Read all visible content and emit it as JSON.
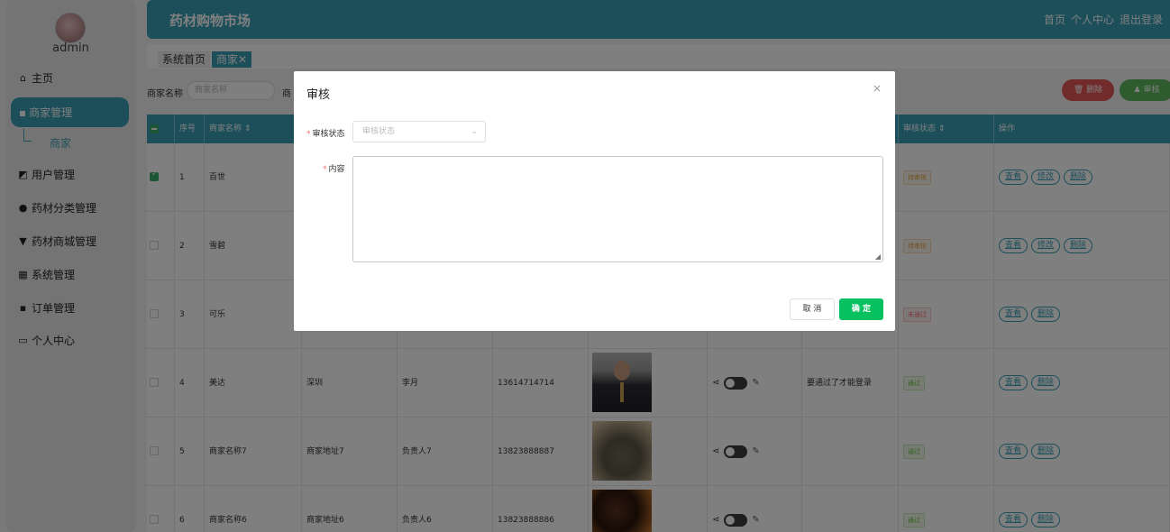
{
  "sidebar": {
    "username": "admin",
    "items": [
      {
        "label": "主页",
        "icon": "home-icon",
        "glyph": "⌂"
      },
      {
        "label": "商家管理",
        "icon": "grid-icon",
        "glyph": "▪"
      },
      {
        "label": "用户管理",
        "icon": "chart-icon",
        "glyph": "◩"
      },
      {
        "label": "药材分类管理",
        "icon": "drop-icon",
        "glyph": "●"
      },
      {
        "label": "药材商城管理",
        "icon": "shop-icon",
        "glyph": "▼"
      },
      {
        "label": "系统管理",
        "icon": "apps-icon",
        "glyph": "▦"
      },
      {
        "label": "订单管理",
        "icon": "order-icon",
        "glyph": "▪"
      },
      {
        "label": "个人中心",
        "icon": "card-icon",
        "glyph": "▭"
      }
    ],
    "sub_item": "商家"
  },
  "header": {
    "title": "药材购物市场",
    "links": [
      "首页",
      "个人中心",
      "退出登录"
    ]
  },
  "tabs": {
    "home": "系统首页",
    "active": "商家",
    "close_glyph": "✕"
  },
  "search": {
    "name_label": "商家名称",
    "name_placeholder": "商家名称",
    "second_label": "商",
    "delete_button": "删除",
    "audit_button": "审核"
  },
  "table": {
    "headers": {
      "index": "序号",
      "name": "商家名称",
      "audit_status": "审核状态",
      "actions": "操作"
    },
    "rows": [
      {
        "no": "1",
        "name": "百世",
        "address": "",
        "contact": "",
        "phone": "",
        "reply": "",
        "status": "待审核",
        "status_type": "pending",
        "checked": true,
        "actions": [
          "查看",
          "修改",
          "删除"
        ],
        "image": ""
      },
      {
        "no": "2",
        "name": "雪碧",
        "address": "",
        "contact": "",
        "phone": "",
        "reply": "",
        "status": "待审核",
        "status_type": "pending",
        "checked": false,
        "actions": [
          "查看",
          "修改",
          "删除"
        ],
        "image": ""
      },
      {
        "no": "3",
        "name": "可乐",
        "address": "",
        "contact": "",
        "phone": "",
        "reply": "",
        "status": "未通过",
        "status_type": "fail",
        "checked": false,
        "actions": [
          "查看",
          "删除"
        ],
        "image": ""
      },
      {
        "no": "4",
        "name": "美达",
        "address": "深圳",
        "contact": "李月",
        "phone": "13614714714",
        "reply": "要通过了才能登录",
        "status": "通过",
        "status_type": "pass",
        "checked": false,
        "actions": [
          "查看",
          "删除"
        ],
        "image": "person-photo"
      },
      {
        "no": "5",
        "name": "商家名称7",
        "address": "商家地址7",
        "contact": "负责人7",
        "phone": "13823888887",
        "reply": "",
        "status": "通过",
        "status_type": "pass",
        "checked": false,
        "actions": [
          "查看",
          "删除"
        ],
        "image": "seeds-photo"
      },
      {
        "no": "6",
        "name": "商家名称6",
        "address": "商家地址6",
        "contact": "负责人6",
        "phone": "13823888886",
        "reply": "",
        "status": "通过",
        "status_type": "pass",
        "checked": false,
        "actions": [
          "查看",
          "删除"
        ],
        "image": "pan-photo"
      }
    ]
  },
  "dialog": {
    "title": "审核",
    "close_glyph": "×",
    "status_label": "审核状态",
    "status_placeholder": "审核状态",
    "content_label": "内容",
    "cancel_button": "取 消",
    "confirm_button": "确 定"
  },
  "colors": {
    "primary": "#3a9fb5",
    "confirm": "#07c160",
    "danger": "#e45656",
    "success": "#5cb85c"
  }
}
